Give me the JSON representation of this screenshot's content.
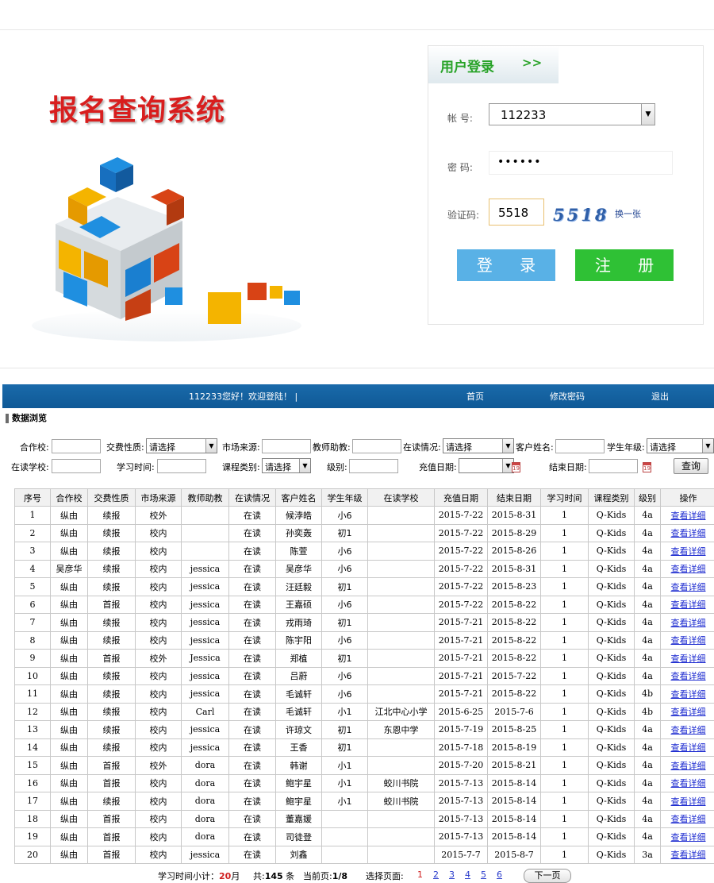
{
  "hero": {
    "title": "报名查询系统"
  },
  "login": {
    "title": "用户登录",
    "arrows": ">>",
    "account_label": "帐  号:",
    "account_value": "112233",
    "password_label": "密  码:",
    "password_value": "••••••",
    "captcha_label": "验证码:",
    "captcha_value": "5518",
    "captcha_image_text": "5518",
    "captcha_refresh": "换一张",
    "login_button": "登  录",
    "register_button": "注  册"
  },
  "nav": {
    "welcome": "112233您好！欢迎登陆！ |",
    "home": "首页",
    "change_password": "修改密码",
    "logout": "退出"
  },
  "section_title": "数据浏览",
  "filters": {
    "partner_school": "合作校:",
    "fee_type": "交费性质:",
    "fee_type_value": "请选择",
    "market_source": "市场来源:",
    "teacher_assistant": "教师助教:",
    "study_status": "在读情况:",
    "study_status_value": "请选择",
    "customer_name": "客户姓名:",
    "grade": "学生年级:",
    "grade_value": "请选择",
    "current_school": "在读学校:",
    "study_time": "学习时间:",
    "course_type": "课程类别:",
    "course_type_value": "请选择",
    "level": "级别:",
    "recharge_date": "充值日期:",
    "end_date": "结束日期:",
    "query_button": "查询"
  },
  "table": {
    "headers": [
      "序号",
      "合作校",
      "交费性质",
      "市场来源",
      "教师助教",
      "在读情况",
      "客户姓名",
      "学生年级",
      "在读学校",
      "充值日期",
      "结束日期",
      "学习时间",
      "课程类别",
      "级别",
      "操作"
    ],
    "rows": [
      [
        "1",
        "纵由",
        "续报",
        "校外",
        "",
        "在读",
        "候浡皓",
        "小6",
        "",
        "2015-7-22",
        "2015-8-31",
        "1",
        "Q-Kids",
        "4a",
        "查看详细"
      ],
      [
        "2",
        "纵由",
        "续报",
        "校内",
        "",
        "在读",
        "孙奕轰",
        "初1",
        "",
        "2015-7-22",
        "2015-8-29",
        "1",
        "Q-Kids",
        "4a",
        "查看详细"
      ],
      [
        "3",
        "纵由",
        "续报",
        "校内",
        "",
        "在读",
        "陈萱",
        "小6",
        "",
        "2015-7-22",
        "2015-8-26",
        "1",
        "Q-Kids",
        "4a",
        "查看详细"
      ],
      [
        "4",
        "吴彦华",
        "续报",
        "校内",
        "jessica",
        "在读",
        "吴彦华",
        "小6",
        "",
        "2015-7-22",
        "2015-8-31",
        "1",
        "Q-Kids",
        "4a",
        "查看详细"
      ],
      [
        "5",
        "纵由",
        "续报",
        "校内",
        "jessica",
        "在读",
        "汪廷毅",
        "初1",
        "",
        "2015-7-22",
        "2015-8-23",
        "1",
        "Q-Kids",
        "4a",
        "查看详细"
      ],
      [
        "6",
        "纵由",
        "首报",
        "校内",
        "jessica",
        "在读",
        "王嘉硕",
        "小6",
        "",
        "2015-7-22",
        "2015-8-22",
        "1",
        "Q-Kids",
        "4a",
        "查看详细"
      ],
      [
        "7",
        "纵由",
        "续报",
        "校内",
        "jessica",
        "在读",
        "戎雨琦",
        "初1",
        "",
        "2015-7-21",
        "2015-8-22",
        "1",
        "Q-Kids",
        "4a",
        "查看详细"
      ],
      [
        "8",
        "纵由",
        "续报",
        "校内",
        "jessica",
        "在读",
        "陈宇阳",
        "小6",
        "",
        "2015-7-21",
        "2015-8-22",
        "1",
        "Q-Kids",
        "4a",
        "查看详细"
      ],
      [
        "9",
        "纵由",
        "首报",
        "校外",
        "Jessica",
        "在读",
        "郑植",
        "初1",
        "",
        "2015-7-21",
        "2015-8-22",
        "1",
        "Q-Kids",
        "4a",
        "查看详细"
      ],
      [
        "10",
        "纵由",
        "续报",
        "校内",
        "jessica",
        "在读",
        "吕蔚",
        "小6",
        "",
        "2015-7-21",
        "2015-7-22",
        "1",
        "Q-Kids",
        "4a",
        "查看详细"
      ],
      [
        "11",
        "纵由",
        "续报",
        "校内",
        "jessica",
        "在读",
        "毛诚轩",
        "小6",
        "",
        "2015-7-21",
        "2015-8-22",
        "1",
        "Q-Kids",
        "4b",
        "查看详细"
      ],
      [
        "12",
        "纵由",
        "续报",
        "校内",
        "Carl",
        "在读",
        "毛诚轩",
        "小1",
        "江北中心小学",
        "2015-6-25",
        "2015-7-6",
        "1",
        "Q-Kids",
        "4b",
        "查看详细"
      ],
      [
        "13",
        "纵由",
        "续报",
        "校内",
        "jessica",
        "在读",
        "许琼文",
        "初1",
        "东恩中学",
        "2015-7-19",
        "2015-8-25",
        "1",
        "Q-Kids",
        "4a",
        "查看详细"
      ],
      [
        "14",
        "纵由",
        "续报",
        "校内",
        "jessica",
        "在读",
        "王香",
        "初1",
        "",
        "2015-7-18",
        "2015-8-19",
        "1",
        "Q-Kids",
        "4a",
        "查看详细"
      ],
      [
        "15",
        "纵由",
        "首报",
        "校外",
        "dora",
        "在读",
        "韩谢",
        "小1",
        "",
        "2015-7-20",
        "2015-8-21",
        "1",
        "Q-Kids",
        "4a",
        "查看详细"
      ],
      [
        "16",
        "纵由",
        "首报",
        "校内",
        "dora",
        "在读",
        "鲍宇星",
        "小1",
        "蛟川书院",
        "2015-7-13",
        "2015-8-14",
        "1",
        "Q-Kids",
        "4a",
        "查看详细"
      ],
      [
        "17",
        "纵由",
        "续报",
        "校内",
        "dora",
        "在读",
        "鲍宇星",
        "小1",
        "蛟川书院",
        "2015-7-13",
        "2015-8-14",
        "1",
        "Q-Kids",
        "4a",
        "查看详细"
      ],
      [
        "18",
        "纵由",
        "首报",
        "校内",
        "dora",
        "在读",
        "董嘉媛",
        "",
        "",
        "2015-7-13",
        "2015-8-14",
        "1",
        "Q-Kids",
        "4a",
        "查看详细"
      ],
      [
        "19",
        "纵由",
        "首报",
        "校内",
        "dora",
        "在读",
        "司徒登",
        "",
        "",
        "2015-7-13",
        "2015-8-14",
        "1",
        "Q-Kids",
        "4a",
        "查看详细"
      ],
      [
        "20",
        "纵由",
        "首报",
        "校内",
        "jessica",
        "在读",
        "刘鑫",
        "",
        "",
        "2015-7-7",
        "2015-8-7",
        "1",
        "Q-Kids",
        "3a",
        "查看详细"
      ]
    ]
  },
  "footer": {
    "subtotal_label": "学习时间小计：",
    "subtotal_value": "20",
    "subtotal_unit": "月",
    "total_prefix": "共:",
    "total_value": "145",
    "total_suffix": " 条",
    "current_page_label": "当前页:",
    "current_page_value": "1/8",
    "select_page_label": "选择页面:",
    "pages": [
      "1",
      "2",
      "3",
      "4",
      "5",
      "6"
    ],
    "next_button": "下一页"
  },
  "colors": {
    "brand_red": "#d81e1e",
    "nav_blue": "#0f5996",
    "login_blue": "#59b1e6",
    "register_green": "#2fc135",
    "link_blue": "#1d2bd0"
  }
}
